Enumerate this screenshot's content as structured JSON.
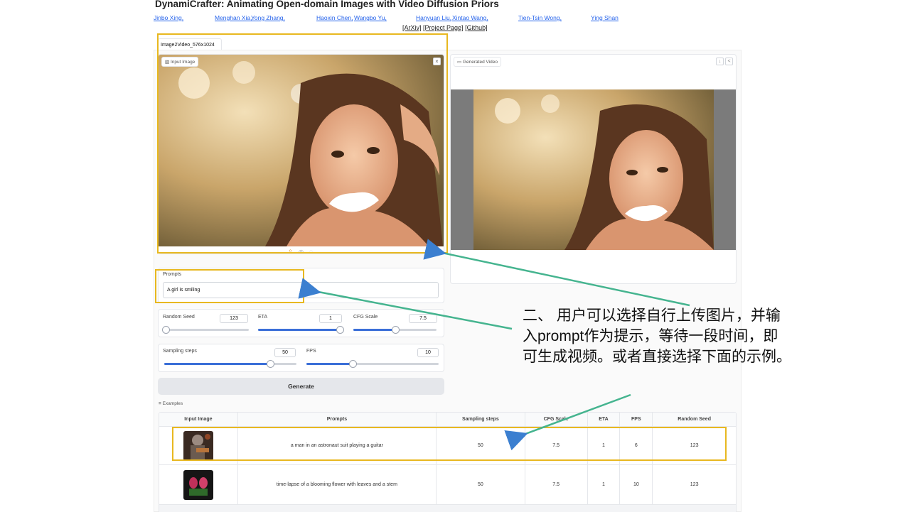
{
  "header": {
    "title": "DynamiCrafter: Animating Open-domain Images with Video Diffusion Priors",
    "authors": [
      "Jinbo Xing,",
      "Menghan Xia,",
      "Yong Zhang,",
      "Haoxin Chen,",
      "Wangbo Yu,",
      "Hanyuan Liu,",
      "Xintao Wang,",
      "Tien-Tsin Wong,",
      "Ying Shan"
    ],
    "links": [
      "[ArXiv]",
      "[Project Page]",
      "[Github]"
    ]
  },
  "tab": {
    "label": "Image2Video_576x1024"
  },
  "input_image": {
    "label": "Input Image",
    "close": "×"
  },
  "output_video": {
    "label": "Generated Video",
    "download": "↓",
    "share": "<"
  },
  "prompt": {
    "label": "Prompts",
    "value": "A girl is smiling"
  },
  "controls": {
    "seed": {
      "label": "Random Seed",
      "value": "123",
      "level": 0.02
    },
    "eta": {
      "label": "ETA",
      "value": "1",
      "level": 1.0
    },
    "cfg": {
      "label": "CFG Scale",
      "value": "7.5",
      "level": 0.5
    },
    "steps": {
      "label": "Sampling steps",
      "value": "50",
      "level": 0.8
    },
    "fps": {
      "label": "FPS",
      "value": "10",
      "level": 0.35
    }
  },
  "generate": {
    "label": "Generate"
  },
  "examples": {
    "label": "Examples",
    "headers": [
      "Input Image",
      "Prompts",
      "Sampling steps",
      "CFG Scale",
      "ETA",
      "FPS",
      "Random Seed"
    ],
    "rows": [
      [
        "",
        "a man in an astronaut suit playing a guitar",
        "50",
        "7.5",
        "1",
        "6",
        "123"
      ],
      [
        "",
        "time-lapse of a blooming flower with leaves and a stem",
        "50",
        "7.5",
        "1",
        "10",
        "123"
      ]
    ]
  },
  "annotation": {
    "text": "二、 用户可以选择自行上传图片，并输入prompt作为提示，等待一段时间，即可生成视频。或者直接选择下面的示例。"
  },
  "colors": {
    "highlight": "#e8b820",
    "arrow_blue": "#3b7fd0",
    "arrow_green": "#45b48f",
    "slider": "#3b6fd8"
  }
}
